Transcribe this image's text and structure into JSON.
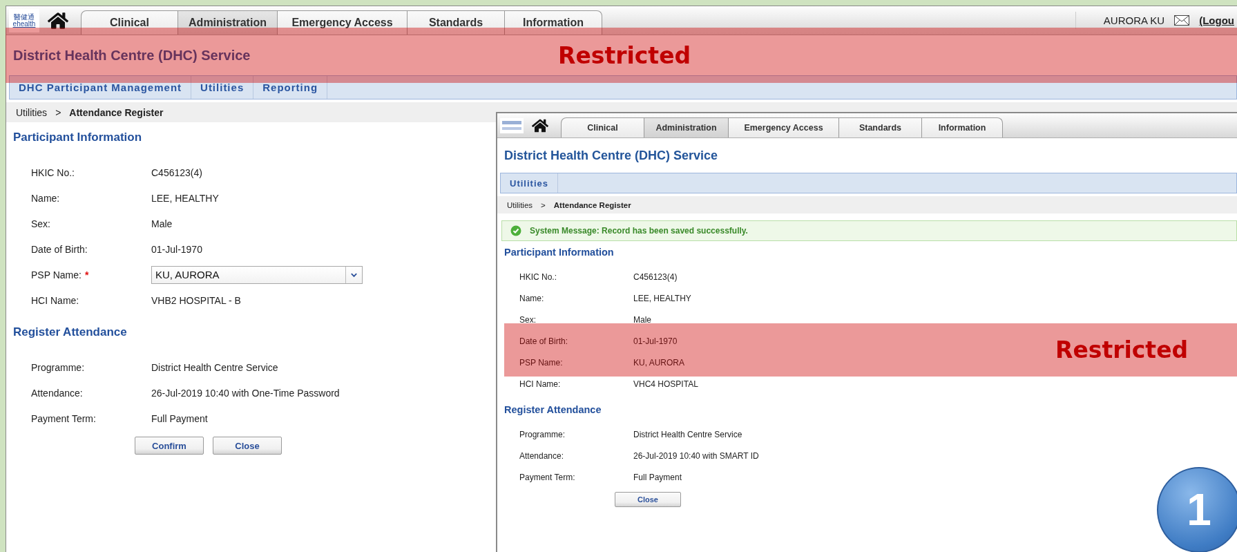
{
  "main": {
    "header": {
      "logo": {
        "mark": "醫健通",
        "word": "ehealth"
      },
      "tabs": [
        {
          "label": "Clinical",
          "selected": false
        },
        {
          "label": "Administration",
          "selected": true
        },
        {
          "label": "Emergency Access",
          "selected": false
        },
        {
          "label": "Standards",
          "selected": false
        },
        {
          "label": "Information",
          "selected": false
        }
      ],
      "user": "AURORA KU",
      "logout": "(Logou"
    },
    "title": "District Health Centre (DHC) Service",
    "restricted": "Restricted",
    "subnav": [
      "DHC Participant Management",
      "Utilities",
      "Reporting"
    ],
    "breadcrumb": {
      "parent": "Utilities",
      "separator": ">",
      "current": "Attendance Register"
    },
    "participant": {
      "heading": "Participant Information",
      "rows": [
        {
          "kind": "text",
          "label": "HKIC No.:",
          "value": "C456123(4)"
        },
        {
          "kind": "text",
          "label": "Name:",
          "value": "LEE, HEALTHY"
        },
        {
          "kind": "text",
          "label": "Sex:",
          "value": "Male"
        },
        {
          "kind": "text",
          "label": "Date of Birth:",
          "value": "01-Jul-1970"
        },
        {
          "kind": "select",
          "label": "PSP Name:",
          "required_mark": "*",
          "value": "KU, AURORA"
        },
        {
          "kind": "text",
          "label": "HCI Name:",
          "value": "VHB2 HOSPITAL - B"
        }
      ]
    },
    "register": {
      "heading": "Register Attendance",
      "rows": [
        {
          "kind": "text",
          "label": "Programme:",
          "value": "District Health Centre Service"
        },
        {
          "kind": "text",
          "label": "Attendance:",
          "value": "26-Jul-2019 10:40 with One-Time Password"
        },
        {
          "kind": "text",
          "label": "Payment Term:",
          "value": "Full Payment"
        }
      ]
    },
    "buttons": [
      "Confirm",
      "Close"
    ]
  },
  "inset": {
    "header": {
      "tabs": [
        {
          "label": "Clinical",
          "selected": false
        },
        {
          "label": "Administration",
          "selected": true
        },
        {
          "label": "Emergency Access",
          "selected": false
        },
        {
          "label": "Standards",
          "selected": false
        },
        {
          "label": "Information",
          "selected": false
        }
      ]
    },
    "title": "District Health Centre (DHC) Service",
    "subnav": [
      "Utilities"
    ],
    "breadcrumb": {
      "parent": "Utilities",
      "separator": ">",
      "current": "Attendance Register"
    },
    "message": "System Message: Record has been saved successfully.",
    "restricted": "Restricted",
    "participant": {
      "heading": "Participant Information",
      "rows": [
        {
          "kind": "text",
          "label": "HKIC No.:",
          "value": "C456123(4)"
        },
        {
          "kind": "text",
          "label": "Name:",
          "value": "LEE, HEALTHY"
        },
        {
          "kind": "text",
          "label": "Sex:",
          "value": "Male"
        },
        {
          "kind": "text",
          "label": "Date of Birth:",
          "value": "01-Jul-1970"
        },
        {
          "kind": "text",
          "label": "PSP Name:",
          "value": "KU, AURORA"
        },
        {
          "kind": "text",
          "label": "HCI Name:",
          "value": "VHC4 HOSPITAL"
        }
      ]
    },
    "register": {
      "heading": "Register Attendance",
      "rows": [
        {
          "kind": "text",
          "label": "Programme:",
          "value": "District Health Centre Service"
        },
        {
          "kind": "text",
          "label": "Attendance:",
          "value": "26-Jul-2019 10:40 with SMART ID"
        },
        {
          "kind": "text",
          "label": "Payment Term:",
          "value": "Full Payment"
        }
      ]
    },
    "buttons": [
      "Close"
    ]
  },
  "badge": "1"
}
